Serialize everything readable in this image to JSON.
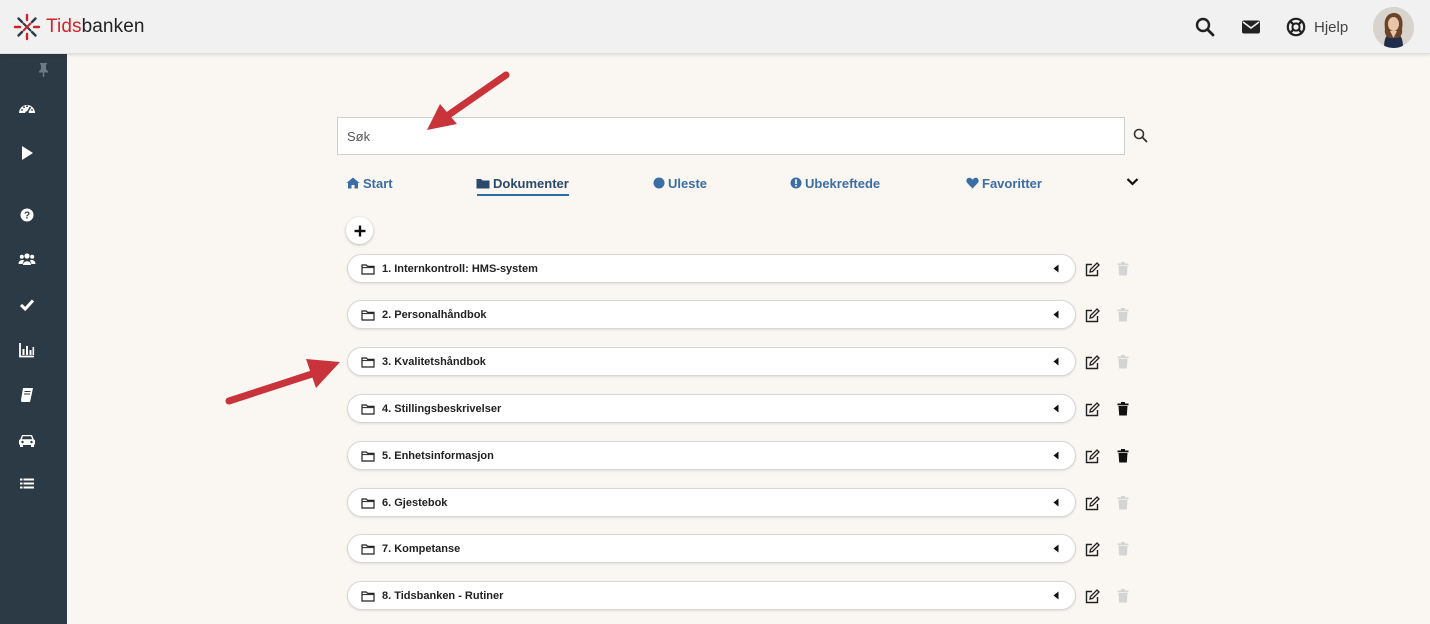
{
  "app": {
    "brand_accent": "Tids",
    "brand_rest": "banken",
    "brand_color": "#d0242b"
  },
  "header": {
    "icons": [
      "search-icon",
      "mail-icon",
      "lifebuoy-icon"
    ],
    "help_label": "Hjelp"
  },
  "sidebar": {
    "icons": [
      "pin-icon",
      "dashboard-icon",
      "play-icon",
      "question-icon",
      "users-icon",
      "check-icon",
      "bar-chart-icon",
      "book-icon",
      "car-icon",
      "list-icon"
    ]
  },
  "search": {
    "placeholder": "Søk"
  },
  "tabs": [
    {
      "label": "Start",
      "icon": "home-icon"
    },
    {
      "label": "Dokumenter",
      "icon": "folder-icon",
      "active": true
    },
    {
      "label": "Uleste",
      "icon": "circle-icon"
    },
    {
      "label": "Ubekreftede",
      "icon": "info-circle-icon"
    },
    {
      "label": "Favoritter",
      "icon": "heart-icon"
    }
  ],
  "folders": [
    {
      "label": "1. Internkontroll: HMS-system",
      "delete_enabled": false
    },
    {
      "label": "2. Personalhåndbok",
      "delete_enabled": false
    },
    {
      "label": "3. Kvalitetshåndbok",
      "delete_enabled": false
    },
    {
      "label": "4. Stillingsbeskrivelser",
      "delete_enabled": true
    },
    {
      "label": "5. Enhetsinformasjon",
      "delete_enabled": true
    },
    {
      "label": "6. Gjestebok",
      "delete_enabled": false
    },
    {
      "label": "7. Kompetanse",
      "delete_enabled": false
    },
    {
      "label": "8. Tidsbanken - Rutiner",
      "delete_enabled": false
    }
  ],
  "colors": {
    "sidebar": "#2c3a45",
    "tab_link": "#3a6ea5",
    "annotation_arrow": "#c9333a"
  }
}
